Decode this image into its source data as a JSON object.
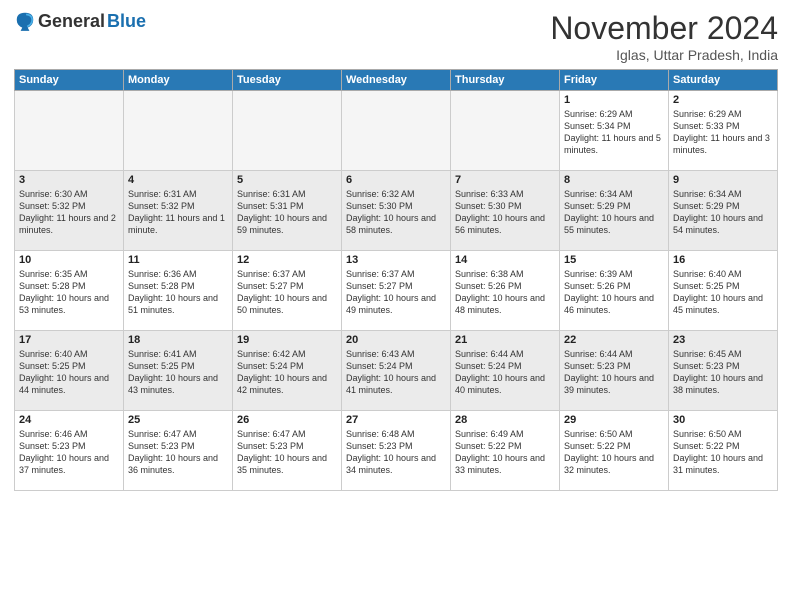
{
  "logo": {
    "general": "General",
    "blue": "Blue"
  },
  "title": "November 2024",
  "location": "Iglas, Uttar Pradesh, India",
  "headers": [
    "Sunday",
    "Monday",
    "Tuesday",
    "Wednesday",
    "Thursday",
    "Friday",
    "Saturday"
  ],
  "weeks": [
    [
      {
        "day": "",
        "info": ""
      },
      {
        "day": "",
        "info": ""
      },
      {
        "day": "",
        "info": ""
      },
      {
        "day": "",
        "info": ""
      },
      {
        "day": "",
        "info": ""
      },
      {
        "day": "1",
        "info": "Sunrise: 6:29 AM\nSunset: 5:34 PM\nDaylight: 11 hours and 5 minutes."
      },
      {
        "day": "2",
        "info": "Sunrise: 6:29 AM\nSunset: 5:33 PM\nDaylight: 11 hours and 3 minutes."
      }
    ],
    [
      {
        "day": "3",
        "info": "Sunrise: 6:30 AM\nSunset: 5:32 PM\nDaylight: 11 hours and 2 minutes."
      },
      {
        "day": "4",
        "info": "Sunrise: 6:31 AM\nSunset: 5:32 PM\nDaylight: 11 hours and 1 minute."
      },
      {
        "day": "5",
        "info": "Sunrise: 6:31 AM\nSunset: 5:31 PM\nDaylight: 10 hours and 59 minutes."
      },
      {
        "day": "6",
        "info": "Sunrise: 6:32 AM\nSunset: 5:30 PM\nDaylight: 10 hours and 58 minutes."
      },
      {
        "day": "7",
        "info": "Sunrise: 6:33 AM\nSunset: 5:30 PM\nDaylight: 10 hours and 56 minutes."
      },
      {
        "day": "8",
        "info": "Sunrise: 6:34 AM\nSunset: 5:29 PM\nDaylight: 10 hours and 55 minutes."
      },
      {
        "day": "9",
        "info": "Sunrise: 6:34 AM\nSunset: 5:29 PM\nDaylight: 10 hours and 54 minutes."
      }
    ],
    [
      {
        "day": "10",
        "info": "Sunrise: 6:35 AM\nSunset: 5:28 PM\nDaylight: 10 hours and 53 minutes."
      },
      {
        "day": "11",
        "info": "Sunrise: 6:36 AM\nSunset: 5:28 PM\nDaylight: 10 hours and 51 minutes."
      },
      {
        "day": "12",
        "info": "Sunrise: 6:37 AM\nSunset: 5:27 PM\nDaylight: 10 hours and 50 minutes."
      },
      {
        "day": "13",
        "info": "Sunrise: 6:37 AM\nSunset: 5:27 PM\nDaylight: 10 hours and 49 minutes."
      },
      {
        "day": "14",
        "info": "Sunrise: 6:38 AM\nSunset: 5:26 PM\nDaylight: 10 hours and 48 minutes."
      },
      {
        "day": "15",
        "info": "Sunrise: 6:39 AM\nSunset: 5:26 PM\nDaylight: 10 hours and 46 minutes."
      },
      {
        "day": "16",
        "info": "Sunrise: 6:40 AM\nSunset: 5:25 PM\nDaylight: 10 hours and 45 minutes."
      }
    ],
    [
      {
        "day": "17",
        "info": "Sunrise: 6:40 AM\nSunset: 5:25 PM\nDaylight: 10 hours and 44 minutes."
      },
      {
        "day": "18",
        "info": "Sunrise: 6:41 AM\nSunset: 5:25 PM\nDaylight: 10 hours and 43 minutes."
      },
      {
        "day": "19",
        "info": "Sunrise: 6:42 AM\nSunset: 5:24 PM\nDaylight: 10 hours and 42 minutes."
      },
      {
        "day": "20",
        "info": "Sunrise: 6:43 AM\nSunset: 5:24 PM\nDaylight: 10 hours and 41 minutes."
      },
      {
        "day": "21",
        "info": "Sunrise: 6:44 AM\nSunset: 5:24 PM\nDaylight: 10 hours and 40 minutes."
      },
      {
        "day": "22",
        "info": "Sunrise: 6:44 AM\nSunset: 5:23 PM\nDaylight: 10 hours and 39 minutes."
      },
      {
        "day": "23",
        "info": "Sunrise: 6:45 AM\nSunset: 5:23 PM\nDaylight: 10 hours and 38 minutes."
      }
    ],
    [
      {
        "day": "24",
        "info": "Sunrise: 6:46 AM\nSunset: 5:23 PM\nDaylight: 10 hours and 37 minutes."
      },
      {
        "day": "25",
        "info": "Sunrise: 6:47 AM\nSunset: 5:23 PM\nDaylight: 10 hours and 36 minutes."
      },
      {
        "day": "26",
        "info": "Sunrise: 6:47 AM\nSunset: 5:23 PM\nDaylight: 10 hours and 35 minutes."
      },
      {
        "day": "27",
        "info": "Sunrise: 6:48 AM\nSunset: 5:23 PM\nDaylight: 10 hours and 34 minutes."
      },
      {
        "day": "28",
        "info": "Sunrise: 6:49 AM\nSunset: 5:22 PM\nDaylight: 10 hours and 33 minutes."
      },
      {
        "day": "29",
        "info": "Sunrise: 6:50 AM\nSunset: 5:22 PM\nDaylight: 10 hours and 32 minutes."
      },
      {
        "day": "30",
        "info": "Sunrise: 6:50 AM\nSunset: 5:22 PM\nDaylight: 10 hours and 31 minutes."
      }
    ]
  ]
}
